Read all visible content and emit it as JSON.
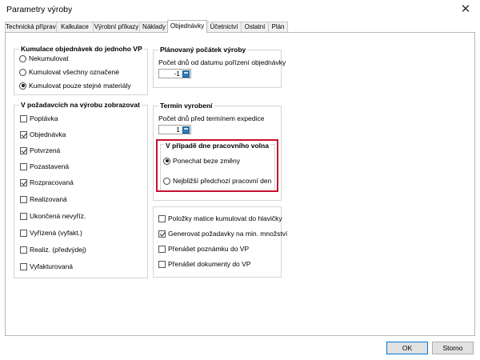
{
  "window": {
    "title": "Parametry výroby",
    "close_glyph": "✕"
  },
  "tabs": [
    {
      "label": "Technická příprava"
    },
    {
      "label": "Kalkulace"
    },
    {
      "label": "Výrobní příkazy"
    },
    {
      "label": "Náklady"
    },
    {
      "label": "Objednávky",
      "active": true
    },
    {
      "label": "Účetnictví"
    },
    {
      "label": "Ostatní"
    },
    {
      "label": "Plán"
    }
  ],
  "kumulace": {
    "title": "Kumulace objednávek do jednoho VP",
    "options": [
      {
        "label": "Nekumulovat",
        "selected": false
      },
      {
        "label": "Kumulovat všechny označené",
        "selected": false
      },
      {
        "label": "Kumulovat pouze stejné materiály",
        "selected": true
      }
    ]
  },
  "pozadavky": {
    "title": "V požadavcích na výrobu zobrazovat",
    "items": [
      {
        "label": "Poptávka",
        "checked": false
      },
      {
        "label": "Objednávka",
        "checked": true
      },
      {
        "label": "Potvrzená",
        "checked": true
      },
      {
        "label": "Pozastavená",
        "checked": false
      },
      {
        "label": "Rozpracovaná",
        "checked": true
      },
      {
        "label": "Realizovaná",
        "checked": false
      },
      {
        "label": "Ukončená nevyříz.",
        "checked": false
      },
      {
        "label": "Vyřízená (vyfakt.)",
        "checked": false
      },
      {
        "label": "Realiz. (předvýdej)",
        "checked": false
      },
      {
        "label": "Vyfakturovaná",
        "checked": false
      }
    ]
  },
  "planovany": {
    "title": "Plánovaný počátek výroby",
    "label": "Počet dnů od datumu pořízení objednávky",
    "value": "-1"
  },
  "termin": {
    "title": "Termín vyrobení",
    "label": "Počet dnů před termínem expedice",
    "value": "1"
  },
  "pracovni_volno": {
    "title": "V případě dne pracovního volna",
    "options": [
      {
        "label": "Ponechat beze změny",
        "selected": true
      },
      {
        "label": "Nejbližší předchozí pracovní den",
        "selected": false
      }
    ],
    "highlight_color": "#c8102e"
  },
  "ostatni": {
    "items": [
      {
        "label": "Položky matice kumulovat do hlavičky",
        "checked": false
      },
      {
        "label": "Generovat požadavky na min. množství",
        "checked": true
      },
      {
        "label": "Přenášet poznámku do VP",
        "checked": false
      },
      {
        "label": "Přenášet dokumenty do VP",
        "checked": false
      }
    ]
  },
  "footer": {
    "ok_label": "OK",
    "cancel_label": "Storno"
  }
}
